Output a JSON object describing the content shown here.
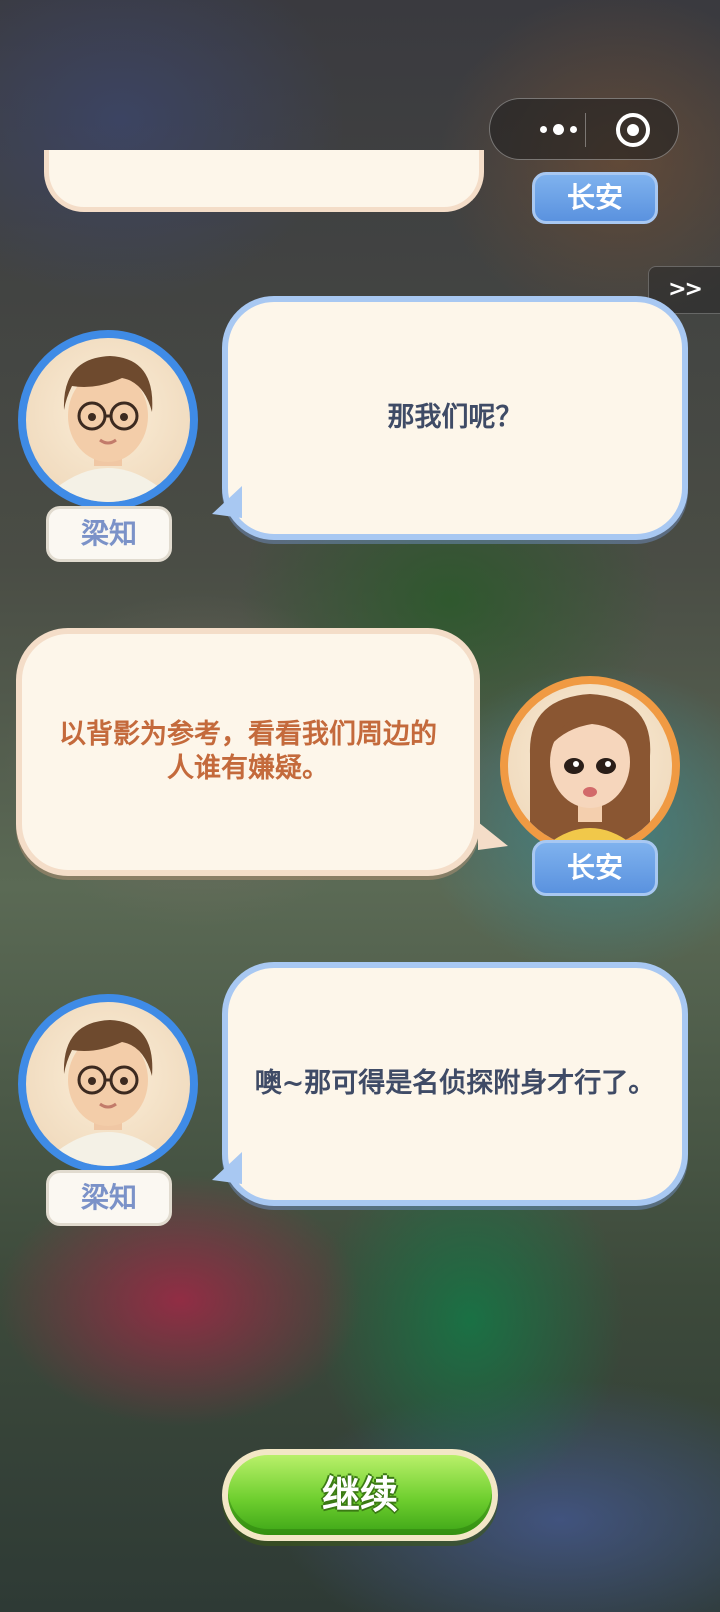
{
  "capsule": {
    "more_icon": "more-dots-icon",
    "close_icon": "target-circle-icon"
  },
  "skip": {
    "label": ">>"
  },
  "dialogue": [
    {
      "speaker": "梁知",
      "text": "那我们呢？",
      "side": "right-bubble"
    },
    {
      "speaker": "长安",
      "text": "以背影为参考，看看我们周边的人谁有嫌疑。",
      "side": "left-bubble"
    },
    {
      "speaker": "梁知",
      "text": "噢~那可得是名侦探附身才行了。",
      "side": "right-bubble"
    }
  ],
  "previous": {
    "speaker": "长安"
  },
  "continue_button": {
    "label": "继续"
  },
  "colors": {
    "bubble_fill": "#fdf6ea",
    "blue_border": "#a8c8f2",
    "peach_border": "#f4ddc8",
    "button_green": "#6fcf2f"
  }
}
